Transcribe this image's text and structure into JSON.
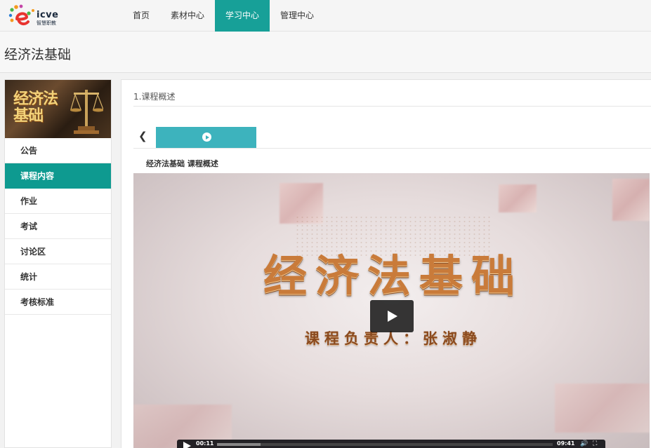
{
  "brand": {
    "name": "icve",
    "subtitle": "智慧职教",
    "colors": {
      "red": "#e8342f",
      "orange": "#f39a1e",
      "blue": "#2a7fd4",
      "purple": "#c445a8",
      "green": "#49b748"
    }
  },
  "nav": {
    "items": [
      {
        "label": "首页",
        "active": false
      },
      {
        "label": "素材中心",
        "active": false
      },
      {
        "label": "学习中心",
        "active": true
      },
      {
        "label": "管理中心",
        "active": false
      }
    ],
    "accent": "#17a098"
  },
  "course": {
    "title": "经济法基础",
    "cover_text": "经济法基础"
  },
  "sidebar": {
    "items": [
      {
        "label": "公告",
        "active": false
      },
      {
        "label": "课程内容",
        "active": true
      },
      {
        "label": "作业",
        "active": false
      },
      {
        "label": "考试",
        "active": false
      },
      {
        "label": "讨论区",
        "active": false
      },
      {
        "label": "统计",
        "active": false
      },
      {
        "label": "考核标准",
        "active": false
      }
    ]
  },
  "content": {
    "section_title": "1.课程概述",
    "resource_title": "经济法基础 课程概述",
    "video_tab_icon": "play-circle-icon",
    "back_icon": "chevron-left-icon"
  },
  "video": {
    "main_title": "经济法基础",
    "sub_title": "课程负责人：张淑静",
    "current_time": "00:11",
    "duration": "09:41",
    "progress": 0.13
  }
}
